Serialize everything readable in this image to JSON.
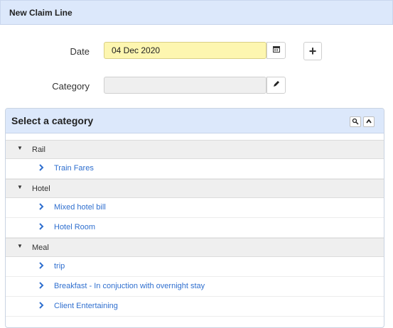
{
  "header": {
    "title": "New Claim Line"
  },
  "form": {
    "date_label": "Date",
    "date_value": "04 Dec 2020",
    "category_label": "Category",
    "category_value": ""
  },
  "panel": {
    "title": "Select a category",
    "groups": [
      {
        "name": "Rail",
        "items": [
          "Train Fares"
        ]
      },
      {
        "name": "Hotel",
        "items": [
          "Mixed hotel bill",
          "Hotel Room"
        ]
      },
      {
        "name": "Meal",
        "items": [
          "trip",
          "Breakfast - In conjuction with overnight stay",
          "Client Entertaining"
        ]
      }
    ]
  },
  "icons": {
    "calendar": "calendar-icon",
    "add": "plus-icon",
    "edit": "pencil-icon",
    "search": "search-icon",
    "collapse": "chevron-up-icon",
    "expanded": "triangle-down-icon",
    "leaf": "chevron-right-icon"
  },
  "colors": {
    "header_bg": "#dce8fb",
    "date_field_bg": "#fdf6b0",
    "link": "#2f6fcf"
  }
}
